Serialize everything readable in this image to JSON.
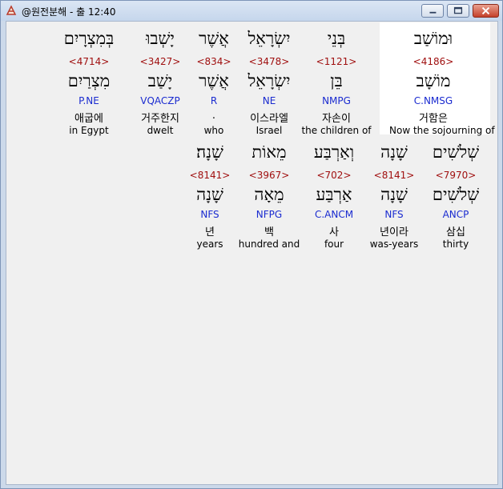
{
  "window": {
    "title": "@원전분해 - 출 12:40",
    "icon": "app-logo-icon",
    "buttons": [
      "minimize-icon",
      "maximize-icon",
      "close-icon"
    ]
  },
  "verse": {
    "rows": [
      {
        "words": [
          {
            "heb": "וּמוֹשַׁב",
            "strong": "<4186>",
            "lemma": "מוֹשָׁב",
            "morph": "C.NMSG",
            "kor": "거함은",
            "eng": "Now the sojourning of",
            "highlighted": true
          },
          {
            "heb": "בְּנֵי",
            "strong": "<1121>",
            "lemma": "בֵּן",
            "morph": "NMPG",
            "kor": "자손이",
            "eng": "the children of"
          },
          {
            "heb": "יִשְׂרָאֵל",
            "strong": "<3478>",
            "lemma": "יִשְׂרָאֵל",
            "morph": "NE",
            "kor": "이스라엘",
            "eng": "Israel"
          },
          {
            "heb": "אֲשֶׁר",
            "strong": "<834>",
            "lemma": "אֲשֶׁר",
            "morph": "R",
            "kor": ".",
            "eng": "who"
          },
          {
            "heb": "יָשְׁבוּ",
            "strong": "<3427>",
            "lemma": "יָשַׁב",
            "morph": "VQACZP",
            "kor": "거주한지",
            "eng": "dwelt"
          },
          {
            "heb": "בְּמִצְרָיִם",
            "strong": "<4714>",
            "lemma": "מִצְרַיִם",
            "morph": "P.NE",
            "kor": "애굽에",
            "eng": "in Egypt"
          }
        ]
      },
      {
        "words": [
          {
            "heb": "שְׁלֹשִׁים",
            "strong": "<7970>",
            "lemma": "שְׁלֹשִׁים",
            "morph": "ANCP",
            "kor": "삼십",
            "eng": "thirty"
          },
          {
            "heb": "שָׁנָה",
            "strong": "<8141>",
            "lemma": "שָׁנָה",
            "morph": "NFS",
            "kor": "년이라",
            "eng": "was-years"
          },
          {
            "heb": "וְאַרְבַּע",
            "strong": "<702>",
            "lemma": "אַרְבַּע",
            "morph": "C.ANCM",
            "kor": "사",
            "eng": "four"
          },
          {
            "heb": "מֵאוֹת",
            "strong": "<3967>",
            "lemma": "מֵאָה",
            "morph": "NFPG",
            "kor": "백",
            "eng": "hundred and"
          },
          {
            "heb": "שָׁנָה׃",
            "strong": "<8141>",
            "lemma": "שָׁנָה",
            "morph": "NFS",
            "kor": "년",
            "eng": "years"
          }
        ]
      }
    ]
  }
}
